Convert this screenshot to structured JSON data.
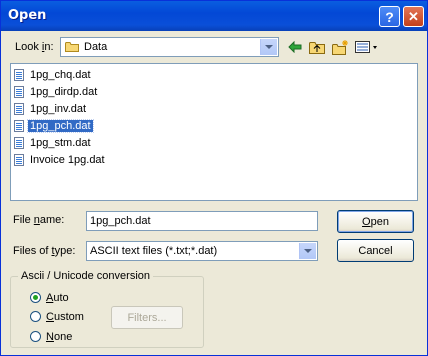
{
  "window": {
    "title": "Open"
  },
  "titlebar": {
    "help_glyph": "?",
    "close_glyph": "✕"
  },
  "lookin": {
    "label_pre": "Look ",
    "label_mnemonic": "i",
    "label_post": "n:",
    "value": "Data"
  },
  "toolbar": {
    "back_icon": "back-arrow-icon",
    "up_icon": "up-folder-icon",
    "newfolder_icon": "new-folder-icon",
    "view_icon": "view-menu-icon"
  },
  "files": [
    "1pg_chq.dat",
    "1pg_dirdp.dat",
    "1pg_inv.dat",
    "1pg_pch.dat",
    "1pg_stm.dat",
    "Invoice 1pg.dat"
  ],
  "filename": {
    "label_pre": "File ",
    "label_mnemonic": "n",
    "label_post": "ame:",
    "value": "1pg_pch.dat"
  },
  "filetype": {
    "label_pre": "Files of ",
    "label_mnemonic": "t",
    "label_post": "ype:",
    "value": "ASCII text files (*.txt;*.dat)"
  },
  "buttons": {
    "open_mnemonic": "O",
    "open_rest": "pen",
    "cancel": "Cancel",
    "filters": "Filters..."
  },
  "conversion": {
    "legend": "Ascii / Unicode conversion",
    "auto_mnemonic": "A",
    "auto_rest": "uto",
    "custom_mnemonic": "C",
    "custom_rest": "ustom",
    "none_mnemonic": "N",
    "none_rest": "one",
    "selected": "Auto"
  }
}
